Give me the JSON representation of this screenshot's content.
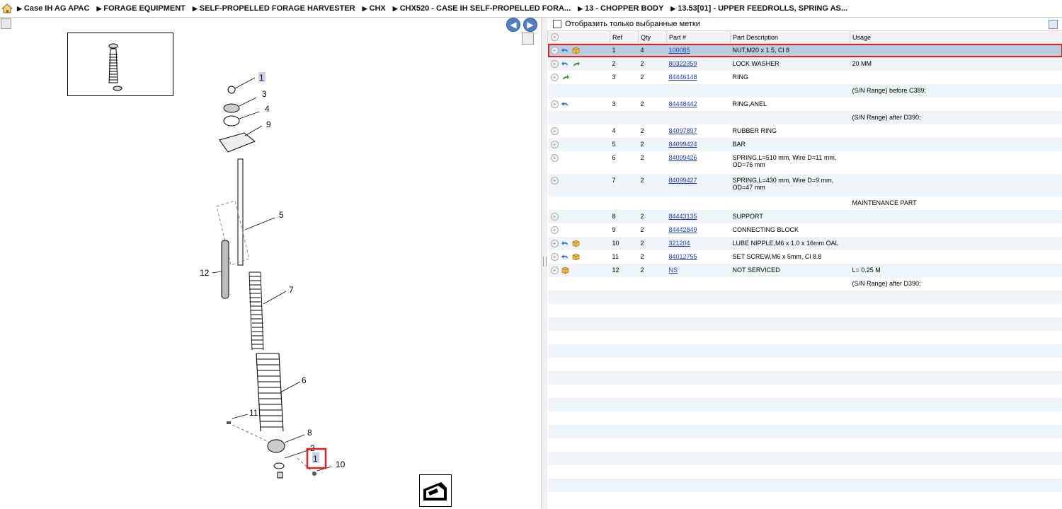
{
  "breadcrumb": [
    "Case IH AG APAC",
    "FORAGE EQUIPMENT",
    "SELF-PROPELLED FORAGE HARVESTER",
    "CHX",
    "CHX520 - CASE IH SELF-PROPELLED FORA...",
    "13 - CHOPPER BODY",
    "13.53[01] - UPPER FEEDROLLS, SPRING AS..."
  ],
  "filter": {
    "label": "Отобразить только выбранные метки"
  },
  "table": {
    "headers": {
      "ref": "Ref",
      "qty": "Qty",
      "part": "Part #",
      "desc": "Part Description",
      "usage": "Usage"
    },
    "rows": [
      {
        "ref": "1",
        "qty": "4",
        "part": "100085",
        "desc": "NUT,M20 x 1.5, Cl 8",
        "usage": "",
        "icons": [
          "undo",
          "box"
        ],
        "selected": true
      },
      {
        "ref": "2",
        "qty": "2",
        "part": "80322359",
        "desc": "LOCK WASHER",
        "usage": "20 MM",
        "icons": [
          "undo",
          "redo"
        ]
      },
      {
        "ref": "3",
        "qty": "2",
        "part": "84446148",
        "desc": "RING",
        "usage": "",
        "icons": [
          "redo"
        ]
      },
      {
        "ref": "",
        "qty": "",
        "part": "",
        "desc": "",
        "usage": "(S/N Range) before C389;",
        "icons": [],
        "note": true
      },
      {
        "ref": "3",
        "qty": "2",
        "part": "84448442",
        "desc": "RING,ANEL",
        "usage": "",
        "icons": [
          "undo"
        ]
      },
      {
        "ref": "",
        "qty": "",
        "part": "",
        "desc": "",
        "usage": "(S/N Range) after D390;",
        "icons": [],
        "note": true
      },
      {
        "ref": "4",
        "qty": "2",
        "part": "84097897",
        "desc": "RUBBER RING",
        "usage": "",
        "icons": []
      },
      {
        "ref": "5",
        "qty": "2",
        "part": "84099424",
        "desc": "BAR",
        "usage": "",
        "icons": []
      },
      {
        "ref": "6",
        "qty": "2",
        "part": "84099426",
        "desc": "SPRING,L=510 mm, Wire D=11 mm, OD=76 mm",
        "usage": "",
        "icons": [],
        "tall": true
      },
      {
        "ref": "7",
        "qty": "2",
        "part": "84099427",
        "desc": "SPRING,L=430 mm, Wire D=9 mm, OD=47 mm",
        "usage": "",
        "icons": [],
        "tall": true
      },
      {
        "ref": "",
        "qty": "",
        "part": "",
        "desc": "",
        "usage": "MAINTENANCE PART",
        "icons": [],
        "note": true
      },
      {
        "ref": "8",
        "qty": "2",
        "part": "84443135",
        "desc": "SUPPORT",
        "usage": "",
        "icons": []
      },
      {
        "ref": "9",
        "qty": "2",
        "part": "84442849",
        "desc": "CONNECTING BLOCK",
        "usage": "",
        "icons": []
      },
      {
        "ref": "10",
        "qty": "2",
        "part": "321204",
        "desc": "LUBE NIPPLE,M6 x 1.0 x 16mm OAL",
        "usage": "",
        "icons": [
          "undo",
          "box"
        ]
      },
      {
        "ref": "11",
        "qty": "2",
        "part": "84012755",
        "desc": "SET SCREW,M6 x 5mm, Cl 8.8",
        "usage": "",
        "icons": [
          "undo",
          "box"
        ]
      },
      {
        "ref": "12",
        "qty": "2",
        "part": "NS",
        "desc": "NOT SERVICED",
        "usage": "L= 0.25 M",
        "icons": [
          "box"
        ]
      },
      {
        "ref": "",
        "qty": "",
        "part": "",
        "desc": "",
        "usage": "(S/N Range) after D390;",
        "icons": [],
        "note": true
      }
    ],
    "empty_rows": 16
  },
  "drawing": {
    "callouts": [
      "1",
      "3",
      "4",
      "9",
      "5",
      "12",
      "7",
      "6",
      "11",
      "8",
      "2",
      "1",
      "10"
    ]
  },
  "colors": {
    "selected_row": "#b9cfe0",
    "highlight": "#e02020",
    "link": "#1d3fb8"
  }
}
